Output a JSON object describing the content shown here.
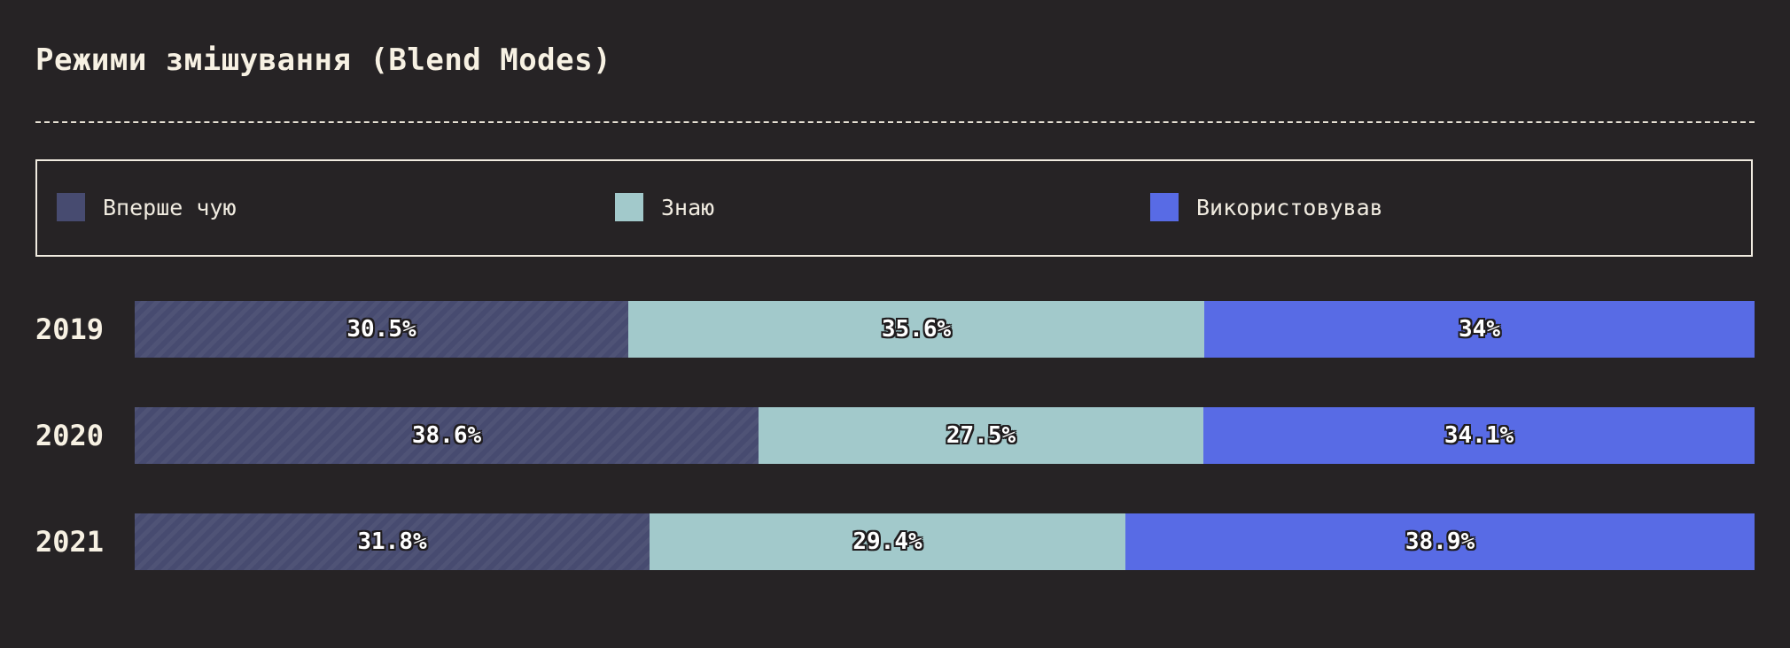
{
  "chart_data": {
    "type": "bar",
    "orientation": "horizontal",
    "stacked": true,
    "normalized_percent": true,
    "title": "Режими змішування (Blend Modes)",
    "categories": [
      "2019",
      "2020",
      "2021"
    ],
    "series": [
      {
        "name": "Вперше чую",
        "color": "#474b70",
        "values": [
          30.5,
          38.6,
          31.8
        ],
        "labels": [
          "30.5%",
          "38.6%",
          "31.8%"
        ]
      },
      {
        "name": "Знаю",
        "color": "#a2c9cb",
        "values": [
          35.6,
          27.5,
          29.4
        ],
        "labels": [
          "35.6%",
          "27.5%",
          "29.4%"
        ]
      },
      {
        "name": "Використовував",
        "color": "#586be5",
        "values": [
          34,
          34.1,
          38.9
        ],
        "labels": [
          "34%",
          "34.1%",
          "38.9%"
        ]
      }
    ],
    "legend_position": "top",
    "grid": false
  },
  "colors": {
    "background": "#262325",
    "text": "#f7f1e3"
  }
}
